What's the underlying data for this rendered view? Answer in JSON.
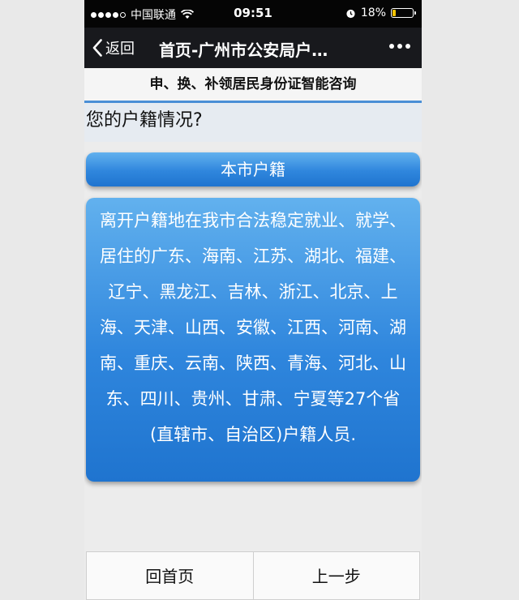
{
  "status_bar": {
    "carrier": "中国联通",
    "time": "09:51",
    "battery_text": "18%",
    "battery_level": 0.18,
    "battery_color": "#f2c200"
  },
  "nav": {
    "back_label": "返回",
    "title": "首页-广州市公安局户…",
    "more_icon": "more-dots-icon"
  },
  "page": {
    "header": "申、换、补领居民身份证智能咨询",
    "question": "您的户籍情况?",
    "options": [
      "本市户籍",
      "离开户籍地在我市合法稳定就业、就学、居住的广东、海南、江苏、湖北、福建、辽宁、黑龙江、吉林、浙江、北京、上海、天津、山西、安徽、江西、河南、湖南、重庆、云南、陕西、青海、河北、山东、四川、贵州、甘肃、宁夏等27个省(直辖市、自治区)户籍人员."
    ]
  },
  "footer": {
    "home_label": "回首页",
    "prev_label": "上一步"
  },
  "colors": {
    "accent": "#2f86dd",
    "navbar": "#18191d"
  }
}
